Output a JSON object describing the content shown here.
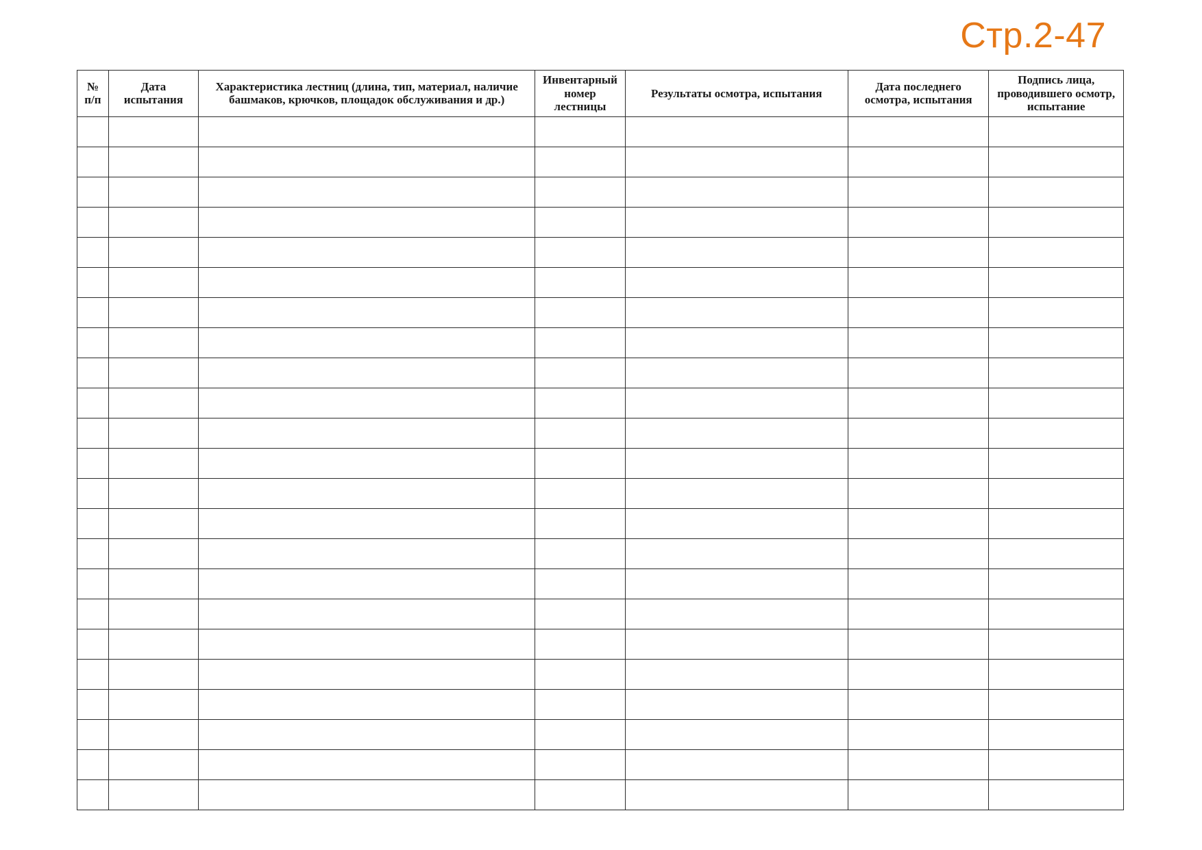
{
  "page_label": "Стр.2-47",
  "table": {
    "headers": [
      "№ п/п",
      "Дата испытания",
      "Характеристика лестниц (длина, тип, материал, наличие башмаков, крючков, площадок обслуживания и др.)",
      "Инвентарный номер лестницы",
      "Результаты осмотра, испытания",
      "Дата последнего осмотра, испытания",
      "Подпись лица, проводившего осмотр, испытание"
    ],
    "row_count": 23,
    "rows": [
      [
        "",
        "",
        "",
        "",
        "",
        "",
        ""
      ],
      [
        "",
        "",
        "",
        "",
        "",
        "",
        ""
      ],
      [
        "",
        "",
        "",
        "",
        "",
        "",
        ""
      ],
      [
        "",
        "",
        "",
        "",
        "",
        "",
        ""
      ],
      [
        "",
        "",
        "",
        "",
        "",
        "",
        ""
      ],
      [
        "",
        "",
        "",
        "",
        "",
        "",
        ""
      ],
      [
        "",
        "",
        "",
        "",
        "",
        "",
        ""
      ],
      [
        "",
        "",
        "",
        "",
        "",
        "",
        ""
      ],
      [
        "",
        "",
        "",
        "",
        "",
        "",
        ""
      ],
      [
        "",
        "",
        "",
        "",
        "",
        "",
        ""
      ],
      [
        "",
        "",
        "",
        "",
        "",
        "",
        ""
      ],
      [
        "",
        "",
        "",
        "",
        "",
        "",
        ""
      ],
      [
        "",
        "",
        "",
        "",
        "",
        "",
        ""
      ],
      [
        "",
        "",
        "",
        "",
        "",
        "",
        ""
      ],
      [
        "",
        "",
        "",
        "",
        "",
        "",
        ""
      ],
      [
        "",
        "",
        "",
        "",
        "",
        "",
        ""
      ],
      [
        "",
        "",
        "",
        "",
        "",
        "",
        ""
      ],
      [
        "",
        "",
        "",
        "",
        "",
        "",
        ""
      ],
      [
        "",
        "",
        "",
        "",
        "",
        "",
        ""
      ],
      [
        "",
        "",
        "",
        "",
        "",
        "",
        ""
      ],
      [
        "",
        "",
        "",
        "",
        "",
        "",
        ""
      ],
      [
        "",
        "",
        "",
        "",
        "",
        "",
        ""
      ],
      [
        "",
        "",
        "",
        "",
        "",
        "",
        ""
      ]
    ]
  }
}
